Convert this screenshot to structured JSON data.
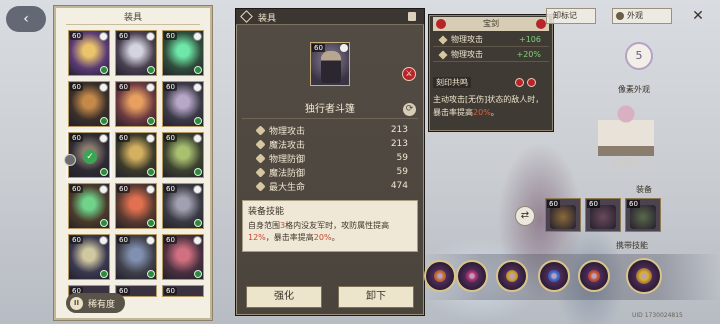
{
  "inventory": {
    "title": "装具",
    "level": "60",
    "rarity_label": "稀有度",
    "rarity_icon": "II",
    "cards": [
      {
        "art": "#5b3b76",
        "accent": "#e9c46a"
      },
      {
        "art": "#4a4050",
        "accent": "#d4d4e0"
      },
      {
        "art": "#2f4d3b",
        "accent": "#6ee7a8"
      },
      {
        "art": "#3a2f2a",
        "accent": "#c48a4a"
      },
      {
        "art": "#6c3a40",
        "accent": "#e8a060"
      },
      {
        "art": "#3c3a48",
        "accent": "#b8a8c8"
      },
      {
        "art": "#2e2b34",
        "accent": "#8a7d70"
      },
      {
        "art": "#3b3a2a",
        "accent": "#d4b060"
      },
      {
        "art": "#3c4230",
        "accent": "#a8c070"
      },
      {
        "art": "#4a3a2a",
        "accent": "#6fd38a"
      },
      {
        "art": "#5a3a30",
        "accent": "#e07050"
      },
      {
        "art": "#3a3a44",
        "accent": "#a0a0b0"
      },
      {
        "art": "#3a3850",
        "accent": "#d0c8a0"
      },
      {
        "art": "#40404a",
        "accent": "#8090b0"
      },
      {
        "art": "#4a3040",
        "accent": "#d07080"
      }
    ],
    "partial_count": 3
  },
  "detail": {
    "header_title": "装具",
    "level": "60",
    "item_name": "独行者斗篷",
    "swap_icon": "⟳",
    "stats": [
      {
        "label": "物理攻击",
        "value": "213"
      },
      {
        "label": "魔法攻击",
        "value": "213"
      },
      {
        "label": "物理防御",
        "value": "59"
      },
      {
        "label": "魔法防御",
        "value": "59"
      },
      {
        "label": "最大生命",
        "value": "474"
      }
    ],
    "skill_title": "装备技能",
    "skill_text_1": "自身范围",
    "skill_hl_1": "3",
    "skill_text_2": "格内没友军时，攻防属性提高",
    "skill_hl_2": "12%",
    "skill_text_3": "，暴击率提高",
    "skill_hl_3": "20%",
    "skill_text_4": "。",
    "enhance_label": "强化",
    "unequip_label": "卸下"
  },
  "tooltip": {
    "title": "宝剑",
    "rows": [
      {
        "label": "物理攻击",
        "value": "+106"
      },
      {
        "label": "物理攻击",
        "value": "+20%"
      }
    ],
    "seal_title": "刻印共鸣",
    "seal_text_1": "主动攻击[无伤]状态的敌人时，暴击率提高",
    "seal_hl": "20%",
    "seal_text_2": "。"
  },
  "top": {
    "record_tab": "卸标记",
    "appearance_tab": "外观",
    "close_glyph": "✕",
    "level_emblem": "5",
    "costume_label": "像素外观",
    "equip_label": "装备",
    "carry_skill_label": "携带技能",
    "uid": "UID 1730024815"
  },
  "equip_slots": [
    {
      "level": "60",
      "art": "#8a6a3a"
    },
    {
      "level": "60",
      "art": "#6a4a5a"
    },
    {
      "level": "60",
      "art": "#5a6a4a"
    }
  ],
  "skills": [
    {
      "core": "#c86a2a"
    },
    {
      "core": "#b02a6a"
    },
    {
      "core": "#d0a020"
    },
    {
      "core": "#3a6ac8"
    },
    {
      "core": "#c8502a"
    },
    {
      "core": "#e0b020"
    }
  ]
}
